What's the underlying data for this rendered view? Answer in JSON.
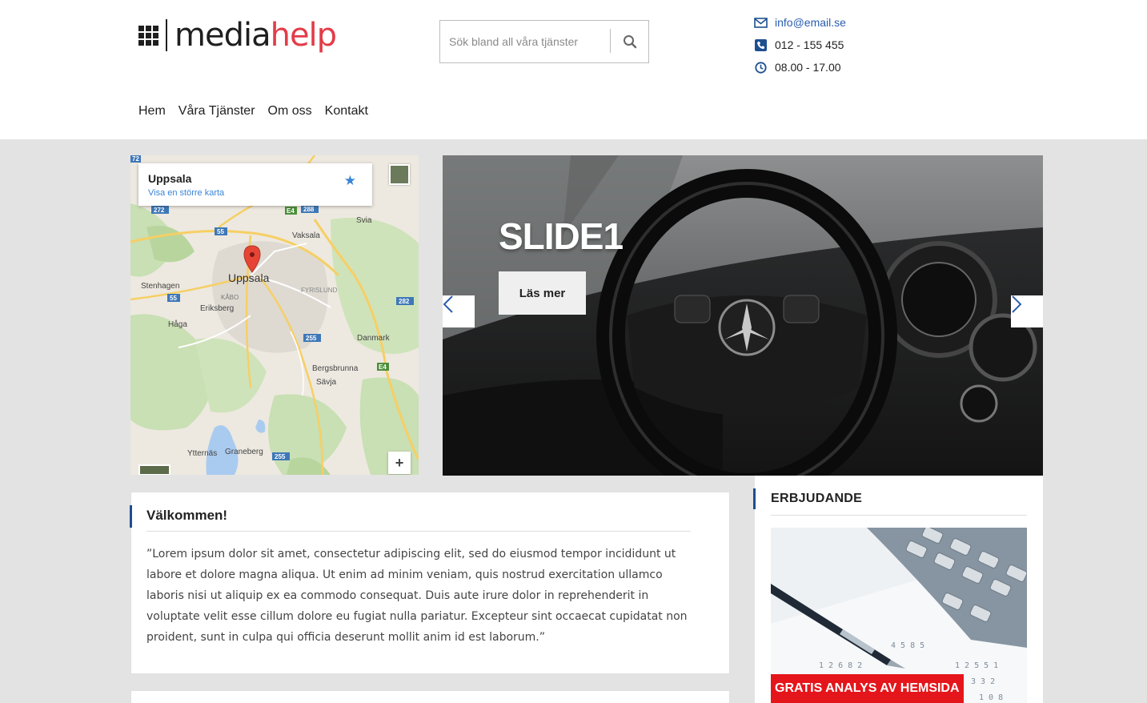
{
  "brand": {
    "logo_dark": "media",
    "logo_light": "help"
  },
  "search": {
    "placeholder": "Sök bland all våra tjänster"
  },
  "contact": {
    "email": "info@email.se",
    "phone": "012 - 155 455",
    "hours": "08.00 - 17.00"
  },
  "nav": {
    "items": [
      "Hem",
      "Våra Tjänster",
      "Om oss",
      "Kontakt"
    ]
  },
  "map": {
    "place_title": "Uppsala",
    "place_link": "Visa en större karta",
    "zoom_in": "+",
    "road_badge": "72",
    "labels": {
      "uppsala": "Uppsala",
      "vaksala": "Vaksala",
      "svia": "Svia",
      "stenhagen": "Stenhagen",
      "kabo": "KÅBO",
      "fyrislund": "FYRISLUND",
      "eriksberg": "Eriksberg",
      "haga": "Håga",
      "danmark": "Danmark",
      "bergsbrunna": "Bergsbrunna",
      "savja": "Sävja",
      "ytternas": "Ytternäs",
      "graneberg": "Graneberg"
    },
    "shields": {
      "r272": "272",
      "e4a": "E4",
      "r288": "288",
      "r55a": "55",
      "r55b": "55",
      "r282": "282",
      "r255a": "255",
      "e4b": "E4",
      "r255b": "255"
    }
  },
  "slider": {
    "title": "SLIDE1",
    "button": "Läs mer"
  },
  "welcome": {
    "title": "Välkommen!",
    "body": "”Lorem ipsum dolor sit amet, consectetur adipiscing elit, sed do eiusmod tempor incididunt ut labore et dolore magna aliqua. Ut enim ad minim veniam, quis nostrud exercitation ullamco laboris nisi ut aliquip ex ea commodo consequat. Duis aute irure dolor in reprehenderit in voluptate velit esse cillum dolore eu fugiat nulla pariatur. Excepteur sint occaecat cupidatat non proident, sunt in culpa qui officia deserunt mollit anim id est laborum.”"
  },
  "offers": {
    "title": "ERBJUDANDE",
    "banner": "GRATIS ANALYS AV HEMSIDA"
  },
  "colors": {
    "accent_blue": "#1d4f91",
    "brand_red": "#e02835",
    "banner_red": "#e4161b",
    "link_blue": "#2a5db0"
  }
}
